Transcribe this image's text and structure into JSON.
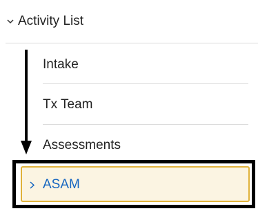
{
  "activity_list": {
    "title": "Activity List",
    "items": [
      {
        "label": "Intake"
      },
      {
        "label": "Tx Team"
      },
      {
        "label": "Assessments"
      }
    ],
    "selected": {
      "label": "ASAM"
    }
  },
  "colors": {
    "accent_text": "#1565c0",
    "selected_border": "#e0b23a",
    "selected_background": "#fbf4e2",
    "highlight_frame": "#000000",
    "divider": "#dcdcdc"
  },
  "icons": {
    "header_toggle": "chevron-down-icon",
    "selected_toggle": "chevron-right-icon",
    "annotation": "down-arrow-icon"
  }
}
